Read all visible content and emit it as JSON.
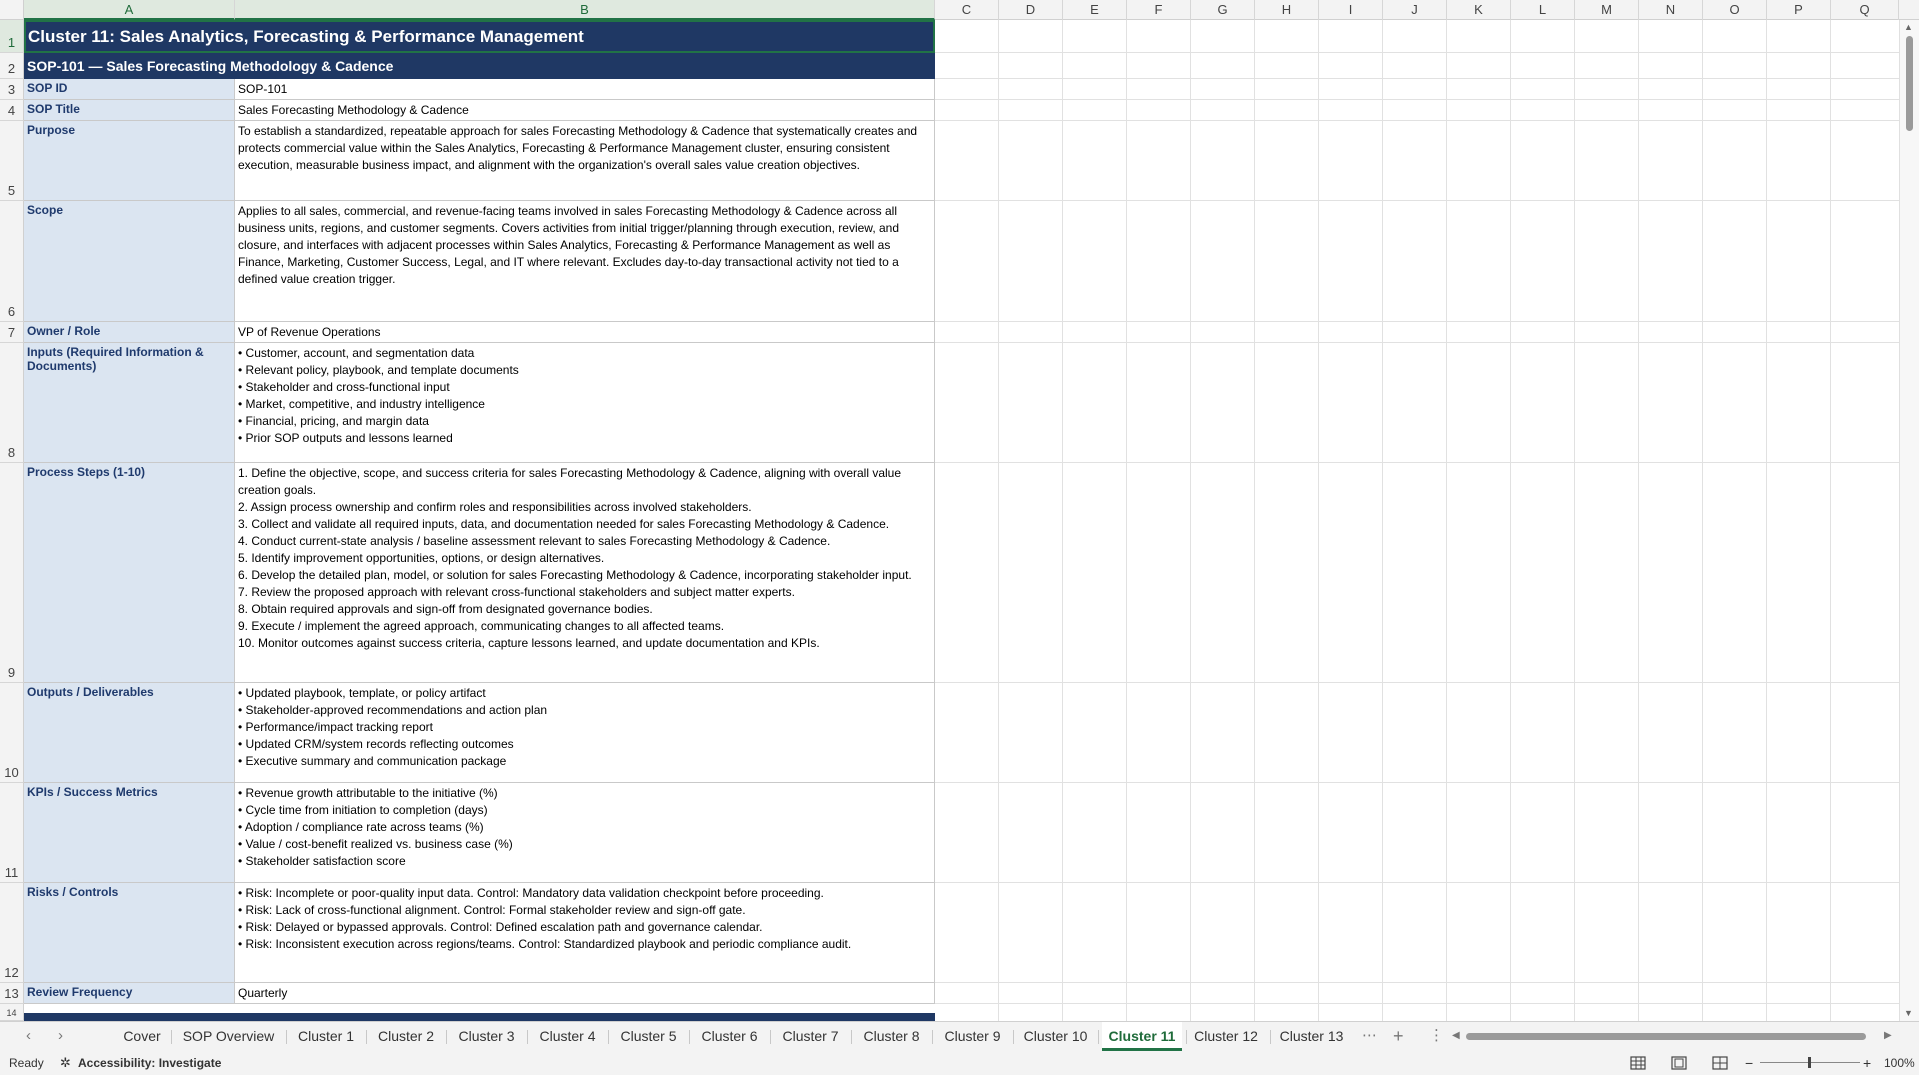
{
  "columns": [
    "A",
    "B",
    "C",
    "D",
    "E",
    "F",
    "G",
    "H",
    "I",
    "J",
    "K",
    "L",
    "M",
    "N",
    "O",
    "P",
    "Q"
  ],
  "rows": [
    "1",
    "2",
    "3",
    "4",
    "5",
    "6",
    "7",
    "8",
    "9",
    "10",
    "11",
    "12",
    "13",
    "14"
  ],
  "sheet": {
    "title": "Cluster 11: Sales Analytics, Forecasting & Performance Management",
    "subtitle": "SOP-101 — Sales Forecasting Methodology & Cadence",
    "fields": [
      {
        "label": "SOP ID",
        "value": "SOP-101"
      },
      {
        "label": "SOP Title",
        "value": "Sales Forecasting Methodology & Cadence"
      },
      {
        "label": "Purpose",
        "value": "To establish a standardized, repeatable approach for sales Forecasting Methodology & Cadence that systematically creates and protects commercial value within the Sales Analytics, Forecasting & Performance Management cluster, ensuring consistent execution, measurable business impact, and alignment with the organization's overall sales value creation objectives."
      },
      {
        "label": "Scope",
        "value": "Applies to all sales, commercial, and revenue-facing teams involved in sales Forecasting Methodology & Cadence across all business units, regions, and customer segments. Covers activities from initial trigger/planning through execution, review, and closure, and interfaces with adjacent processes within Sales Analytics, Forecasting & Performance Management as well as Finance, Marketing, Customer Success, Legal, and IT where relevant. Excludes day-to-day transactional activity not tied to a defined value creation trigger."
      },
      {
        "label": "Owner / Role",
        "value": "VP of Revenue Operations"
      },
      {
        "label": "Inputs (Required Information & Documents)",
        "value": "• Customer, account, and segmentation data\n• Relevant policy, playbook, and template documents\n• Stakeholder and cross-functional input\n• Market, competitive, and industry intelligence\n• Financial, pricing, and margin data\n• Prior SOP outputs and lessons learned"
      },
      {
        "label": "Process Steps (1-10)",
        "value": "1. Define the objective, scope, and success criteria for sales Forecasting Methodology & Cadence, aligning with overall value creation goals.\n2. Assign process ownership and confirm roles and responsibilities across involved stakeholders.\n3. Collect and validate all required inputs, data, and documentation needed for sales Forecasting Methodology & Cadence.\n4. Conduct current-state analysis / baseline assessment relevant to sales Forecasting Methodology & Cadence.\n5. Identify improvement opportunities, options, or design alternatives.\n6. Develop the detailed plan, model, or solution for sales Forecasting Methodology & Cadence, incorporating stakeholder input.\n7. Review the proposed approach with relevant cross-functional stakeholders and subject matter experts.\n8. Obtain required approvals and sign-off from designated governance bodies.\n9. Execute / implement the agreed approach, communicating changes to all affected teams.\n10. Monitor outcomes against success criteria, capture lessons learned, and update documentation and KPIs."
      },
      {
        "label": "Outputs / Deliverables",
        "value": "• Updated playbook, template, or policy artifact\n• Stakeholder-approved recommendations and action plan\n• Performance/impact tracking report\n• Updated CRM/system records reflecting outcomes\n• Executive summary and communication package"
      },
      {
        "label": "KPIs / Success Metrics",
        "value": "• Revenue growth attributable to the initiative (%)\n• Cycle time from initiation to completion (days)\n• Adoption / compliance rate across teams (%)\n• Value / cost-benefit realized vs. business case (%)\n• Stakeholder satisfaction score"
      },
      {
        "label": "Risks / Controls",
        "value": "• Risk: Incomplete or poor-quality input data. Control: Mandatory data validation checkpoint before proceeding.\n• Risk: Lack of cross-functional alignment. Control: Formal stakeholder review and sign-off gate.\n• Risk: Delayed or bypassed approvals. Control: Defined escalation path and governance calendar.\n• Risk: Inconsistent execution across regions/teams. Control: Standardized playbook and periodic compliance audit."
      },
      {
        "label": "Review Frequency",
        "value": "Quarterly"
      }
    ]
  },
  "tabs": [
    "Cover",
    "SOP Overview",
    "Cluster 1",
    "Cluster 2",
    "Cluster 3",
    "Cluster 4",
    "Cluster 5",
    "Cluster 6",
    "Cluster 7",
    "Cluster 8",
    "Cluster 9",
    "Cluster 10",
    "Cluster 11",
    "Cluster 12",
    "Cluster 13"
  ],
  "active_tab": "Cluster 11",
  "tab_controls": {
    "more": "⋯",
    "add": "+",
    "options": "⋮",
    "prev": "‹",
    "next": "›",
    "scroll_left": "◀",
    "scroll_right": "▶"
  },
  "status": {
    "ready": "Ready",
    "accessibility": "Accessibility: Investigate",
    "zoom": "100%",
    "minus": "−",
    "plus": "+"
  },
  "colors": {
    "header_navy": "#1f3864",
    "label_fill": "#dbe5f1",
    "label_text": "#1f3a6d",
    "accent_green": "#217346"
  }
}
